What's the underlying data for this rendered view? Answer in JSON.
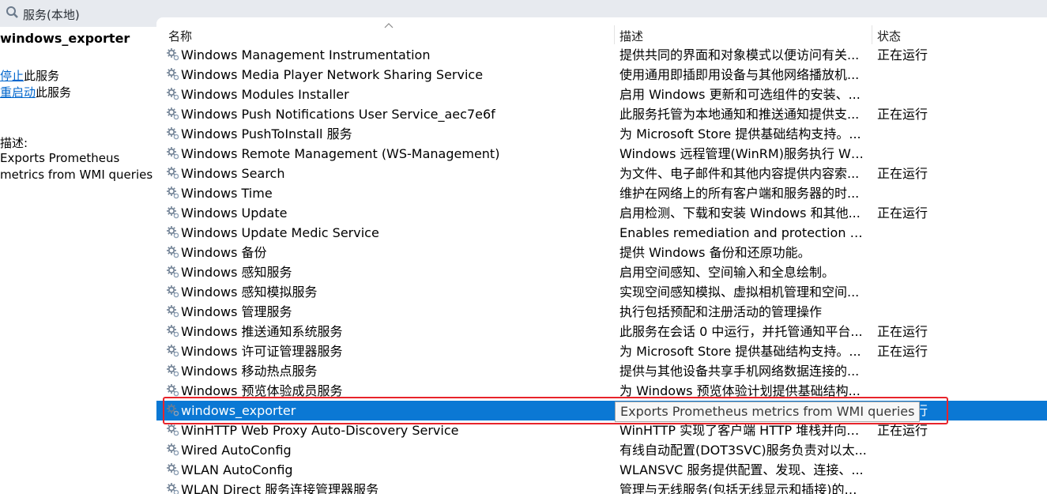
{
  "window": {
    "title": "服务(本地)",
    "icon": "services-icon"
  },
  "left_panel": {
    "service_name": "windows_exporter",
    "stop_link": "停止",
    "stop_suffix": "此服务",
    "restart_link": "重启动",
    "restart_suffix": "此服务",
    "desc_label": "描述:",
    "desc_text": "Exports Prometheus metrics from WMI queries"
  },
  "table": {
    "headers": {
      "name": "名称",
      "description": "描述",
      "status": "状态"
    },
    "sort": "ascending",
    "rows": [
      {
        "name": "Windows Management Instrumentation",
        "desc": "提供共同的界面和对象模式以便访问有关...",
        "status": "正在运行"
      },
      {
        "name": "Windows Media Player Network Sharing Service",
        "desc": "使用通用即插即用设备与其他网络播放机...",
        "status": ""
      },
      {
        "name": "Windows Modules Installer",
        "desc": "启用 Windows 更新和可选组件的安装、...",
        "status": ""
      },
      {
        "name": "Windows Push Notifications User Service_aec7e6f",
        "desc": "此服务托管为本地通知和推送通知提供支...",
        "status": "正在运行"
      },
      {
        "name": "Windows PushToInstall 服务",
        "desc": "为 Microsoft Store 提供基础结构支持。...",
        "status": ""
      },
      {
        "name": "Windows Remote Management (WS-Management)",
        "desc": "Windows 远程管理(WinRM)服务执行 WS...",
        "status": ""
      },
      {
        "name": "Windows Search",
        "desc": "为文件、电子邮件和其他内容提供内容索...",
        "status": "正在运行"
      },
      {
        "name": "Windows Time",
        "desc": "维护在网络上的所有客户端和服务器的时...",
        "status": ""
      },
      {
        "name": "Windows Update",
        "desc": "启用检测、下载和安装 Windows 和其他...",
        "status": "正在运行"
      },
      {
        "name": "Windows Update Medic Service",
        "desc": "Enables remediation and protection of ...",
        "status": ""
      },
      {
        "name": "Windows 备份",
        "desc": "提供 Windows 备份和还原功能。",
        "status": ""
      },
      {
        "name": "Windows 感知服务",
        "desc": "启用空间感知、空间输入和全息绘制。",
        "status": ""
      },
      {
        "name": "Windows 感知模拟服务",
        "desc": "实现空间感知模拟、虚拟相机管理和空间...",
        "status": ""
      },
      {
        "name": "Windows 管理服务",
        "desc": "执行包括预配和注册活动的管理操作",
        "status": ""
      },
      {
        "name": "Windows 推送通知系统服务",
        "desc": "此服务在会话 0 中运行，并托管通知平台...",
        "status": "正在运行"
      },
      {
        "name": "Windows 许可证管理器服务",
        "desc": "为 Microsoft Store 提供基础结构支持。...",
        "status": "正在运行"
      },
      {
        "name": "Windows 移动热点服务",
        "desc": "提供与其他设备共享手机网络数据连接的...",
        "status": ""
      },
      {
        "name": "Windows 预览体验成员服务",
        "desc": "为 Windows 预览体验计划提供基础结构...",
        "status": ""
      },
      {
        "name": "windows_exporter",
        "desc": "Exports Prometheus metrics from WMI queries",
        "status": "正在运行",
        "selected": true
      },
      {
        "name": "WinHTTP Web Proxy Auto-Discovery Service",
        "desc": "WinHTTP 实现了客户端 HTTP 堆栈并向开...",
        "status": "正在运行"
      },
      {
        "name": "Wired AutoConfig",
        "desc": "有线自动配置(DOT3SVC)服务负责对以太...",
        "status": ""
      },
      {
        "name": "WLAN AutoConfig",
        "desc": "WLANSVC 服务提供配置、发现、连接、...",
        "status": ""
      },
      {
        "name": "WLAN Direct 服务连接管理器服务",
        "desc": "管理与无线服务(包括无线显示和插接)的连...",
        "status": ""
      }
    ]
  },
  "tooltip": "Exports Prometheus metrics from WMI queries",
  "colors": {
    "selection": "#0b78d4",
    "highlight_box": "#e8242b",
    "link": "#0066cc"
  }
}
